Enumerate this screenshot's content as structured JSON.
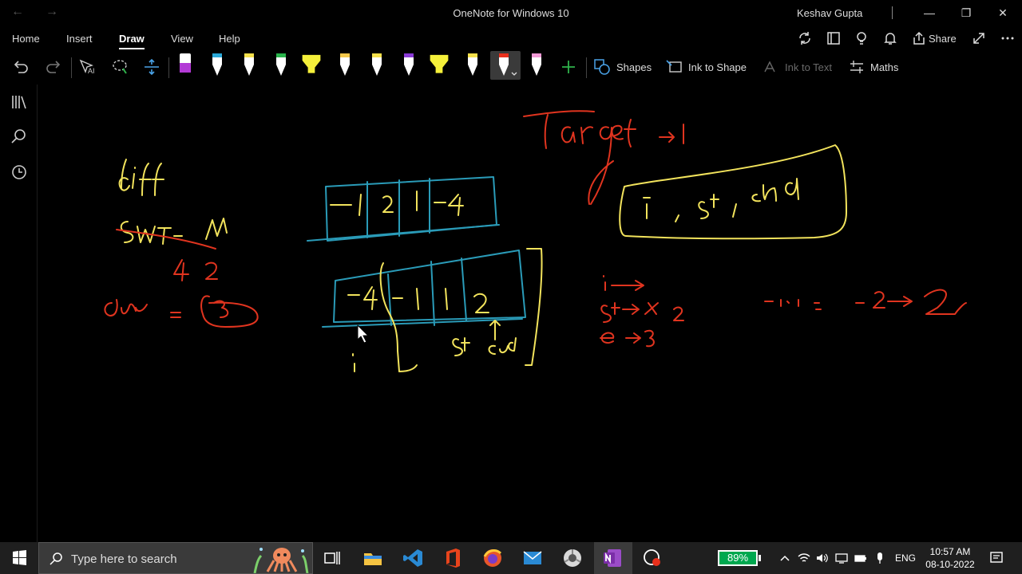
{
  "window": {
    "title": "OneNote for Windows 10",
    "user": "Keshav Gupta"
  },
  "ribbon": {
    "tabs": [
      "Home",
      "Insert",
      "Draw",
      "View",
      "Help"
    ],
    "active_tab": "Draw",
    "share_label": "Share"
  },
  "toolbar": {
    "shapes_label": "Shapes",
    "ink_to_shape_label": "Ink to Shape",
    "ink_to_text_label": "Ink to Text",
    "maths_label": "Maths",
    "pens": [
      {
        "name": "pen-purple",
        "color": "#b33ad6"
      },
      {
        "name": "pen-blue",
        "color": "#2aa8d8"
      },
      {
        "name": "pen-yellow",
        "color": "#f5e04b"
      },
      {
        "name": "pen-green",
        "color": "#29b34b"
      },
      {
        "name": "highlighter-yellow",
        "color": "#f5f03a"
      },
      {
        "name": "pen-yellow-2",
        "color": "#f5e04b"
      },
      {
        "name": "pen-yellow-3",
        "color": "#f5e04b"
      },
      {
        "name": "pen-violet",
        "color": "#8a3ad6"
      },
      {
        "name": "highlighter-yellow-2",
        "color": "#f5f03a"
      },
      {
        "name": "pen-yellow-4",
        "color": "#f5e04b"
      },
      {
        "name": "pen-red",
        "color": "#e8301c"
      },
      {
        "name": "pen-pink",
        "color": "#f29ad6"
      }
    ]
  },
  "canvas": {
    "ink_colors": {
      "yellow": "#f2e35c",
      "blue": "#2a9bb8",
      "red": "#e0341f"
    }
  },
  "taskbar": {
    "search_placeholder": "Type here to search",
    "battery": "89%",
    "language": "ENG",
    "time": "10:57 AM",
    "date": "08-10-2022"
  }
}
